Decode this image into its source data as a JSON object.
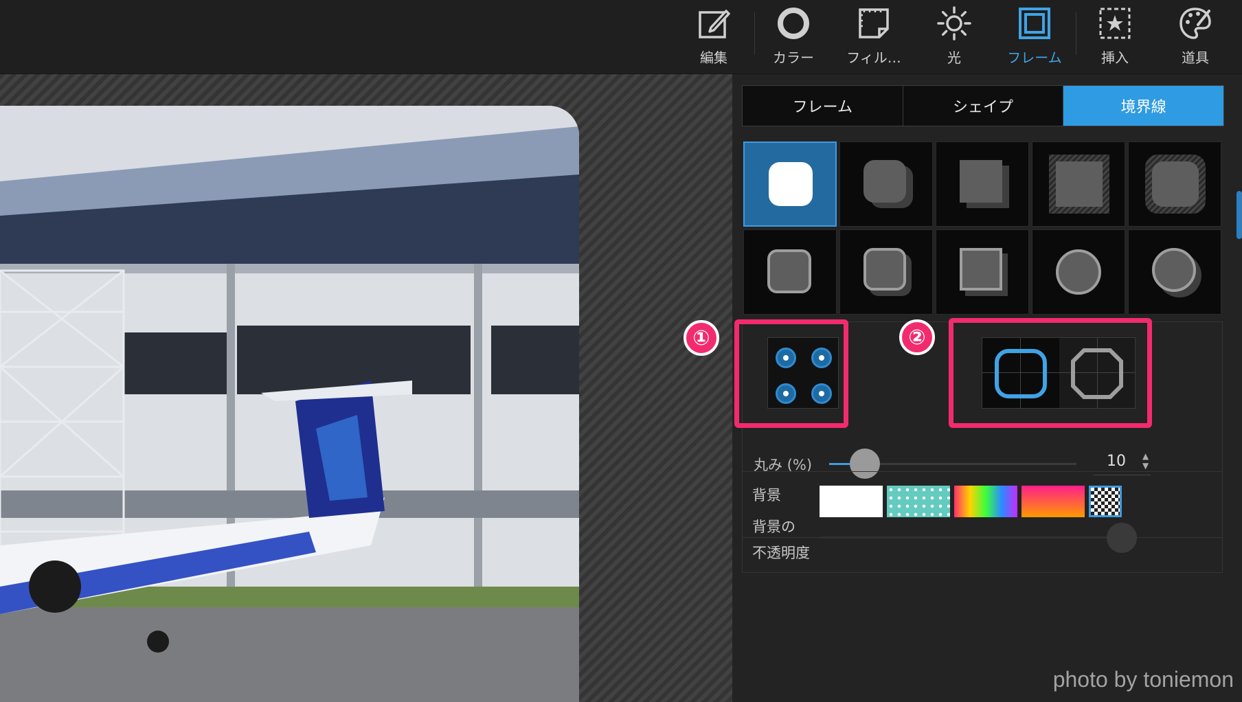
{
  "toolbar": {
    "tools": [
      {
        "label": "編集",
        "icon": "edit-icon"
      },
      {
        "label": "カラー",
        "icon": "color-ring-icon"
      },
      {
        "label": "フィル…",
        "icon": "film-frame-icon"
      },
      {
        "label": "光",
        "icon": "sun-icon"
      },
      {
        "label": "フレーム",
        "icon": "frame-icon",
        "active": true
      },
      {
        "label": "挿入",
        "icon": "star-frame-icon"
      },
      {
        "label": "道具",
        "icon": "palette-brush-icon"
      }
    ]
  },
  "panel": {
    "tabs": [
      "フレーム",
      "シェイプ",
      "境界線"
    ],
    "active_tab": "境界線",
    "badge1": "①",
    "badge2": "②",
    "roundness_label": "丸み (%)",
    "roundness_value": "10",
    "background_label": "背景",
    "opacity_label_1": "背景の",
    "opacity_label_2": "不透明度"
  },
  "credit": "photo by toniemon",
  "colors": {
    "accent": "#2f9be2",
    "highlight": "#f22b6f"
  }
}
